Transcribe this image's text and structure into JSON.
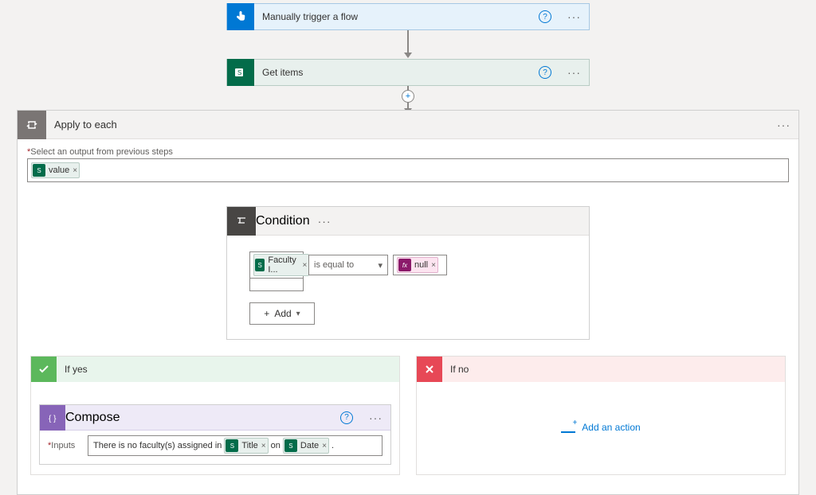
{
  "trigger": {
    "label": "Manually trigger a flow"
  },
  "getitems": {
    "label": "Get items"
  },
  "applyEach": {
    "label": "Apply to each",
    "outputLabel": "Select an output from previous steps",
    "token": "value"
  },
  "condition": {
    "label": "Condition",
    "leftToken": "Faculty I...",
    "operator": "is equal to",
    "rightToken": "null",
    "addLabel": "Add"
  },
  "branchYes": {
    "label": "If yes",
    "compose": {
      "label": "Compose",
      "inputsLabel": "Inputs",
      "text1": "There is no faculty(s) assigned in",
      "token1": "Title",
      "text2": "on",
      "token2": "Date",
      "text3": "."
    }
  },
  "branchNo": {
    "label": "If no",
    "addActionLabel": "Add an action"
  }
}
